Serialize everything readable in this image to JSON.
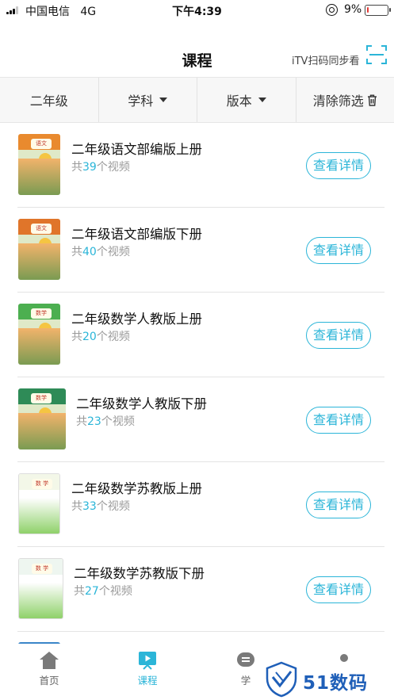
{
  "status_bar": {
    "carrier": "中国电信",
    "network": "4G",
    "time": "下午4:39",
    "battery": "9%",
    "battery_level": 0.09
  },
  "nav": {
    "title": "课程",
    "itv_label": "iTV扫码同步看"
  },
  "filters": [
    {
      "label": "二年级",
      "has_caret": false
    },
    {
      "label": "学科",
      "has_caret": true
    },
    {
      "label": "版本",
      "has_caret": true
    },
    {
      "label": "清除筛选",
      "has_caret": false
    }
  ],
  "courses": [
    {
      "title": "二年级语文部编版上册",
      "count_prefix": "共",
      "count": "39",
      "count_suffix": "个视频",
      "button": "查看详情",
      "cover_tag": "语文",
      "cover_color": "#e98a2e"
    },
    {
      "title": "二年级语文部编版下册",
      "count_prefix": "共",
      "count": "40",
      "count_suffix": "个视频",
      "button": "查看详情",
      "cover_tag": "语文",
      "cover_color": "#e0752a"
    },
    {
      "title": "二年级数学人教版上册",
      "count_prefix": "共",
      "count": "20",
      "count_suffix": "个视频",
      "button": "查看详情",
      "cover_tag": "数学",
      "cover_color": "#4caf50"
    },
    {
      "title": "二年级数学人教版下册",
      "count_prefix": "共",
      "count": "23",
      "count_suffix": "个视频",
      "button": "查看详情",
      "cover_tag": "数学",
      "cover_color": "#2e8b57"
    },
    {
      "title": "二年级数学苏教版上册",
      "count_prefix": "共",
      "count": "33",
      "count_suffix": "个视频",
      "button": "查看详情",
      "cover_tag": "数 学",
      "cover_color": "#f3f7e8"
    },
    {
      "title": "二年级数学苏教版下册",
      "count_prefix": "共",
      "count": "27",
      "count_suffix": "个视频",
      "button": "查看详情",
      "cover_tag": "数 学",
      "cover_color": "#eef6f0"
    }
  ],
  "tabs": [
    {
      "label": "首页",
      "active": false
    },
    {
      "label": "课程",
      "active": true
    },
    {
      "label": "学",
      "active": false
    },
    {
      "label": "",
      "active": false
    }
  ],
  "watermark": {
    "text": "51数码"
  },
  "colors": {
    "accent": "#2bb5d8",
    "count_gray": "#9a9a9a",
    "battery_low": "#e53935",
    "watermark_blue": "#1f5fb8"
  }
}
